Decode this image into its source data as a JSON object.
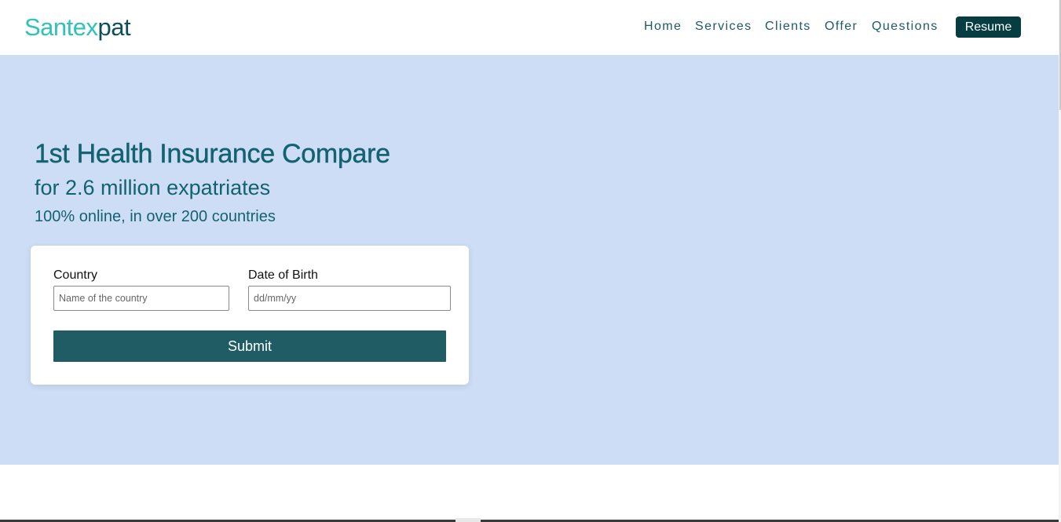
{
  "brand": {
    "part1": "Santex",
    "part2": "pat",
    "color1": "#2ec4b6",
    "color2": "#0b4f57"
  },
  "nav": {
    "links": [
      "Home",
      "Services",
      "Clients",
      "Offer",
      "Questions"
    ],
    "resume_label": "Resume",
    "resume_bg": "#063d43"
  },
  "hero": {
    "title": "1st Health Insurance Compare",
    "subtitle": "for 2.6 million expatriates",
    "tagline": "100% online, in over 200 countries",
    "background": "#cdddf5",
    "text_color": "#136270"
  },
  "form": {
    "country_label": "Country",
    "country_placeholder": "Name of the country",
    "country_value": "",
    "dob_label": "Date of Birth",
    "dob_placeholder": "dd/mm/yy",
    "dob_value": "",
    "submit_label": "Submit",
    "submit_bg": "#1f5c63"
  }
}
